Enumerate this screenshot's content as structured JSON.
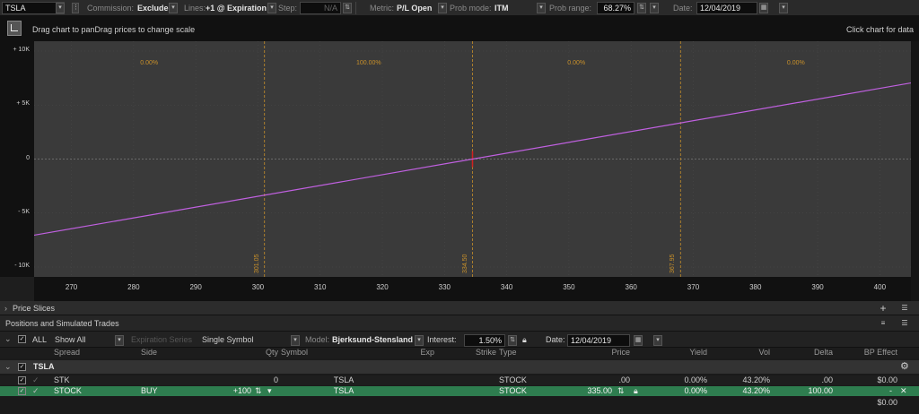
{
  "toolbar": {
    "symbol": "TSLA",
    "commission_label": "Commission:",
    "commission_value": "Exclude",
    "lines_label": "Lines:",
    "lines_value": "+1 @ Expiration",
    "step_label": "Step:",
    "step_value": "N/A",
    "metric_label": "Metric:",
    "metric_value": "P/L Open",
    "prob_mode_label": "Prob mode:",
    "prob_mode_value": "ITM",
    "prob_range_label": "Prob range:",
    "prob_range_value": "68.27%",
    "date_label": "Date:",
    "date_value": "12/04/2019"
  },
  "hint": {
    "left": "Drag chart to panDrag prices to change scale",
    "right": "Click chart for data"
  },
  "chart_data": {
    "type": "line",
    "title": "",
    "xlabel": "",
    "ylabel": "",
    "xlim": [
      264,
      405
    ],
    "ylim": [
      -10000,
      10000
    ],
    "x_ticks": [
      "270",
      "280",
      "290",
      "300",
      "310",
      "320",
      "330",
      "340",
      "350",
      "360",
      "370",
      "380",
      "390",
      "400"
    ],
    "y_ticks": [
      "+ 10K",
      "+ 5K",
      "0",
      "- 5K",
      "- 10K"
    ],
    "series": [
      {
        "name": "",
        "color": "#c060e0",
        "x": [
          264,
          405
        ],
        "y": [
          -7050,
          7050
        ]
      }
    ],
    "vertical_lines": [
      {
        "x": 301.05,
        "label": "301.05"
      },
      {
        "x": 334.5,
        "label": "334.50"
      },
      {
        "x": 367.95,
        "label": "367.95"
      }
    ],
    "current_price": 334.5,
    "region_probs": [
      {
        "x": 282.5,
        "label": "0.00%"
      },
      {
        "x": 317.8,
        "label": "100.00%"
      },
      {
        "x": 351.2,
        "label": "0.00%"
      },
      {
        "x": 386.5,
        "label": "0.00%"
      }
    ]
  },
  "panels": {
    "price_slices": "Price Slices",
    "positions": "Positions and Simulated Trades"
  },
  "grid_toolbar": {
    "all_label": "ALL",
    "show_all": "Show All",
    "expiration_series": "Expiration Series",
    "single_symbol": "Single Symbol",
    "model_label": "Model:",
    "model_value": "Bjerksund-Stensland",
    "interest_label": "Interest:",
    "interest_value": "1.50%",
    "date_label": "Date:",
    "date_value": "12/04/2019"
  },
  "columns": {
    "spread": "Spread",
    "side": "Side",
    "qty": "Qty",
    "symbol": "Symbol",
    "exp": "Exp",
    "strike": "Strike",
    "type": "Type",
    "price": "Price",
    "yield": "Yield",
    "vol": "Vol",
    "delta": "Delta",
    "bp_effect": "BP Effect"
  },
  "group": {
    "name": "TSLA"
  },
  "rows": [
    {
      "spread": "STK",
      "side": "",
      "qty": "0",
      "symbol": "TSLA",
      "exp": "",
      "strike": "",
      "type": "STOCK",
      "price": ".00",
      "yield": "0.00%",
      "vol": "43.20%",
      "delta": ".00",
      "bp": "$0.00"
    },
    {
      "spread": "STOCK",
      "side": "BUY",
      "qty": "+100",
      "symbol": "TSLA",
      "exp": "",
      "strike": "",
      "type": "STOCK",
      "price": "335.00",
      "yield": "0.00%",
      "vol": "43.20%",
      "delta": "100.00",
      "bp": "-"
    }
  ],
  "total": {
    "bp": "$0.00"
  },
  "colors": {
    "accent": "#c8902a",
    "line": "#c060e0",
    "selected_row": "#2e7d4f",
    "current_price_marker": "#d02020"
  }
}
